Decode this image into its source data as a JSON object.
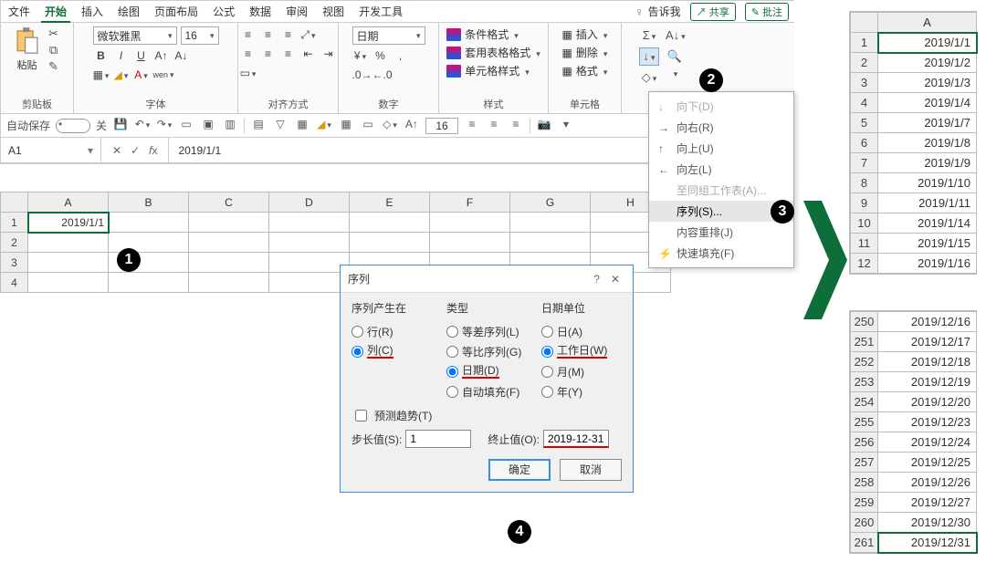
{
  "ribbon": {
    "tabs": [
      "文件",
      "开始",
      "插入",
      "绘图",
      "页面布局",
      "公式",
      "数据",
      "审阅",
      "视图",
      "开发工具"
    ],
    "active_tab": "开始",
    "tell_me": "告诉我",
    "share": "共享",
    "comment": "批注",
    "paste_label": "粘贴",
    "group_clipboard": "剪贴板",
    "group_font": "字体",
    "group_align": "对齐方式",
    "group_number": "数字",
    "group_styles": "样式",
    "group_cells": "单元格",
    "font_name": "微软雅黑",
    "font_size": "16",
    "number_format": "日期",
    "styles_cond": "条件格式",
    "styles_table": "套用表格格式",
    "styles_cell": "单元格样式",
    "cells_insert": "插入",
    "cells_delete": "删除",
    "cells_format": "格式"
  },
  "qat": {
    "autosave": "自动保存",
    "autosave_state": "关",
    "zoom_val": "16"
  },
  "formula_bar": {
    "name_box": "A1",
    "formula": "2019/1/1"
  },
  "sheet": {
    "columns": [
      "A",
      "B",
      "C",
      "D",
      "E",
      "F",
      "G",
      "H"
    ],
    "selected_value": "2019/1/1"
  },
  "fill_menu": {
    "down": "向下(D)",
    "right": "向右(R)",
    "up": "向上(U)",
    "left": "向左(L)",
    "across": "至同组工作表(A)...",
    "series": "序列(S)...",
    "justify": "内容重排(J)",
    "flash": "快速填充(F)"
  },
  "dialog": {
    "title": "序列",
    "series_in": "序列产生在",
    "row": "行(R)",
    "col": "列(C)",
    "type": "类型",
    "linear": "等差序列(L)",
    "growth": "等比序列(G)",
    "date": "日期(D)",
    "autofill": "自动填充(F)",
    "date_unit": "日期单位",
    "day": "日(A)",
    "weekday": "工作日(W)",
    "month": "月(M)",
    "year": "年(Y)",
    "trend": "预测趋势(T)",
    "step_label": "步长值(S):",
    "step_value": "1",
    "stop_label": "终止值(O):",
    "stop_value": "2019-12-31",
    "ok": "确定",
    "cancel": "取消"
  },
  "result_top": {
    "col": "A",
    "rows": [
      {
        "n": "1",
        "v": "2019/1/1"
      },
      {
        "n": "2",
        "v": "2019/1/2"
      },
      {
        "n": "3",
        "v": "2019/1/3"
      },
      {
        "n": "4",
        "v": "2019/1/4"
      },
      {
        "n": "5",
        "v": "2019/1/7"
      },
      {
        "n": "6",
        "v": "2019/1/8"
      },
      {
        "n": "7",
        "v": "2019/1/9"
      },
      {
        "n": "8",
        "v": "2019/1/10"
      },
      {
        "n": "9",
        "v": "2019/1/11"
      },
      {
        "n": "10",
        "v": "2019/1/14"
      },
      {
        "n": "11",
        "v": "2019/1/15"
      },
      {
        "n": "12",
        "v": "2019/1/16"
      }
    ]
  },
  "result_bottom": {
    "rows": [
      {
        "n": "250",
        "v": "2019/12/16"
      },
      {
        "n": "251",
        "v": "2019/12/17"
      },
      {
        "n": "252",
        "v": "2019/12/18"
      },
      {
        "n": "253",
        "v": "2019/12/19"
      },
      {
        "n": "254",
        "v": "2019/12/20"
      },
      {
        "n": "255",
        "v": "2019/12/23"
      },
      {
        "n": "256",
        "v": "2019/12/24"
      },
      {
        "n": "257",
        "v": "2019/12/25"
      },
      {
        "n": "258",
        "v": "2019/12/26"
      },
      {
        "n": "259",
        "v": "2019/12/27"
      },
      {
        "n": "260",
        "v": "2019/12/30"
      },
      {
        "n": "261",
        "v": "2019/12/31"
      }
    ]
  },
  "badges": {
    "b1": "1",
    "b2": "2",
    "b3": "3",
    "b4": "4"
  }
}
